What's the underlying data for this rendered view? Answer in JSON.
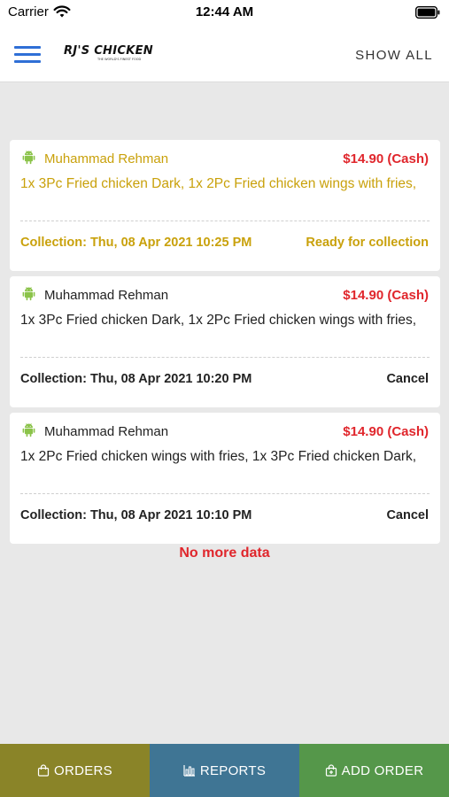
{
  "status_bar": {
    "carrier": "Carrier",
    "time": "12:44 AM",
    "icons": [
      "wifi-icon",
      "battery-icon"
    ]
  },
  "header": {
    "menu_icon": "hamburger-menu-icon",
    "brand_name": "RJ'S CHICKEN",
    "brand_tagline": "THE WORLD'S FINEST FOOD",
    "show_all_label": "SHOW ALL",
    "accent_color": "#2f6fd6"
  },
  "orders": [
    {
      "platform_icon": "android-icon",
      "customer": "Muhammad Rehman",
      "price": "$14.90 (Cash)",
      "items": "1x 3Pc Fried chicken Dark, 1x 2Pc Fried chicken wings with fries,",
      "collection": "Collection: Thu, 08 Apr 2021 10:25 PM",
      "status": "Ready for collection",
      "highlighted": true
    },
    {
      "platform_icon": "android-icon",
      "customer": "Muhammad Rehman",
      "price": "$14.90 (Cash)",
      "items": "1x 3Pc Fried chicken Dark, 1x 2Pc Fried chicken wings with fries,",
      "collection": "Collection: Thu, 08 Apr 2021 10:20 PM",
      "status": "Cancel",
      "highlighted": false
    },
    {
      "platform_icon": "android-icon",
      "customer": "Muhammad Rehman",
      "price": "$14.90 (Cash)",
      "items": "1x 2Pc Fried chicken wings with fries, 1x 3Pc Fried chicken Dark,",
      "collection": "Collection: Thu, 08 Apr 2021 10:10 PM",
      "status": "Cancel",
      "highlighted": false
    }
  ],
  "list_footer": "No more data",
  "colors": {
    "price": "#e0262c",
    "ready": "#c9a10b",
    "tab_orders": "#8a8428",
    "tab_reports": "#3f7594",
    "tab_add_order": "#55974a"
  },
  "tabs": [
    {
      "label": "ORDERS",
      "icon": "bag-icon"
    },
    {
      "label": "REPORTS",
      "icon": "bar-chart-icon"
    },
    {
      "label": "ADD ORDER",
      "icon": "add-bag-icon"
    }
  ]
}
